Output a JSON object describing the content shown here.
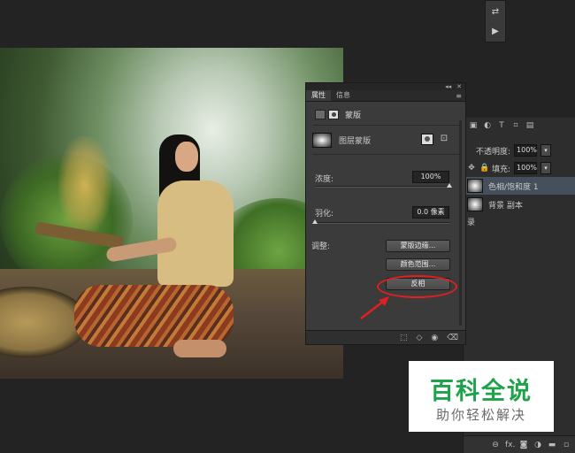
{
  "tool_strip": {
    "icon_1": "⇄",
    "icon_2": "▶"
  },
  "layers_panel": {
    "opacity_label": "不透明度:",
    "opacity_value": "100%",
    "fill_label": "填充:",
    "fill_value": "100%",
    "layers": [
      {
        "name": "色相/饱和度 1",
        "selected": true
      },
      {
        "name": "背景 副本",
        "selected": false
      }
    ],
    "partial_text": "录",
    "bottom_icons": [
      "link-icon",
      "fx-icon",
      "mask-icon",
      "adjustment-icon",
      "folder-icon",
      "new-layer-icon",
      "trash-icon"
    ],
    "fx_label": "fx."
  },
  "properties_panel": {
    "tabs": [
      "属性",
      "信息"
    ],
    "active_tab": "属性",
    "mask_header_label": "蒙版",
    "layer_mask_label": "图层蒙版",
    "density_label": "浓度:",
    "density_value": "100%",
    "density_fraction": 1.0,
    "feather_label": "羽化:",
    "feather_value": "0.0 像素",
    "feather_fraction": 0.0,
    "refine_label": "调整:",
    "buttons": [
      "蒙版边缘...",
      "颜色范围...",
      "反相"
    ],
    "footer_icons": [
      "selection-icon",
      "apply-mask-icon",
      "visibility-icon",
      "delete-icon"
    ],
    "topbar_collapse": "◂◂",
    "topbar_close": "✕",
    "menu_icon": "≡"
  },
  "highlight_colors": {
    "annotation": "#e02020"
  },
  "watermark": {
    "title": "百科全说",
    "subtitle": "助你轻松解决",
    "title_color": "#1fa34a"
  }
}
